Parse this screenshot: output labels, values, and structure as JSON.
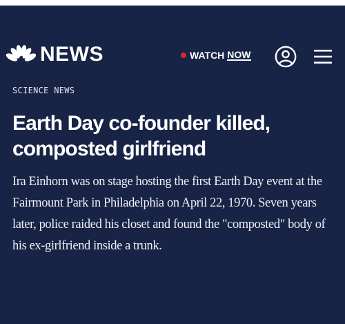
{
  "header": {
    "brand": "NEWS",
    "watch_label": "WATCH",
    "watch_now": "NOW",
    "live_dot_color": "#e2232f",
    "account_icon": "account-circle-icon",
    "menu_icon": "hamburger-menu-icon"
  },
  "article": {
    "category": "SCIENCE NEWS",
    "headline": "Earth Day co-founder killed, composted girlfriend",
    "dek": "Ira Einhorn was on stage hosting the first Earth Day event at the Fairmount Park in Philadelphia on April 22, 1970. Seven years later, police raided his closet and found the \"composted\" body of his ex-girlfriend inside a trunk."
  },
  "colors": {
    "background": "#182446",
    "text": "#ffffff"
  }
}
